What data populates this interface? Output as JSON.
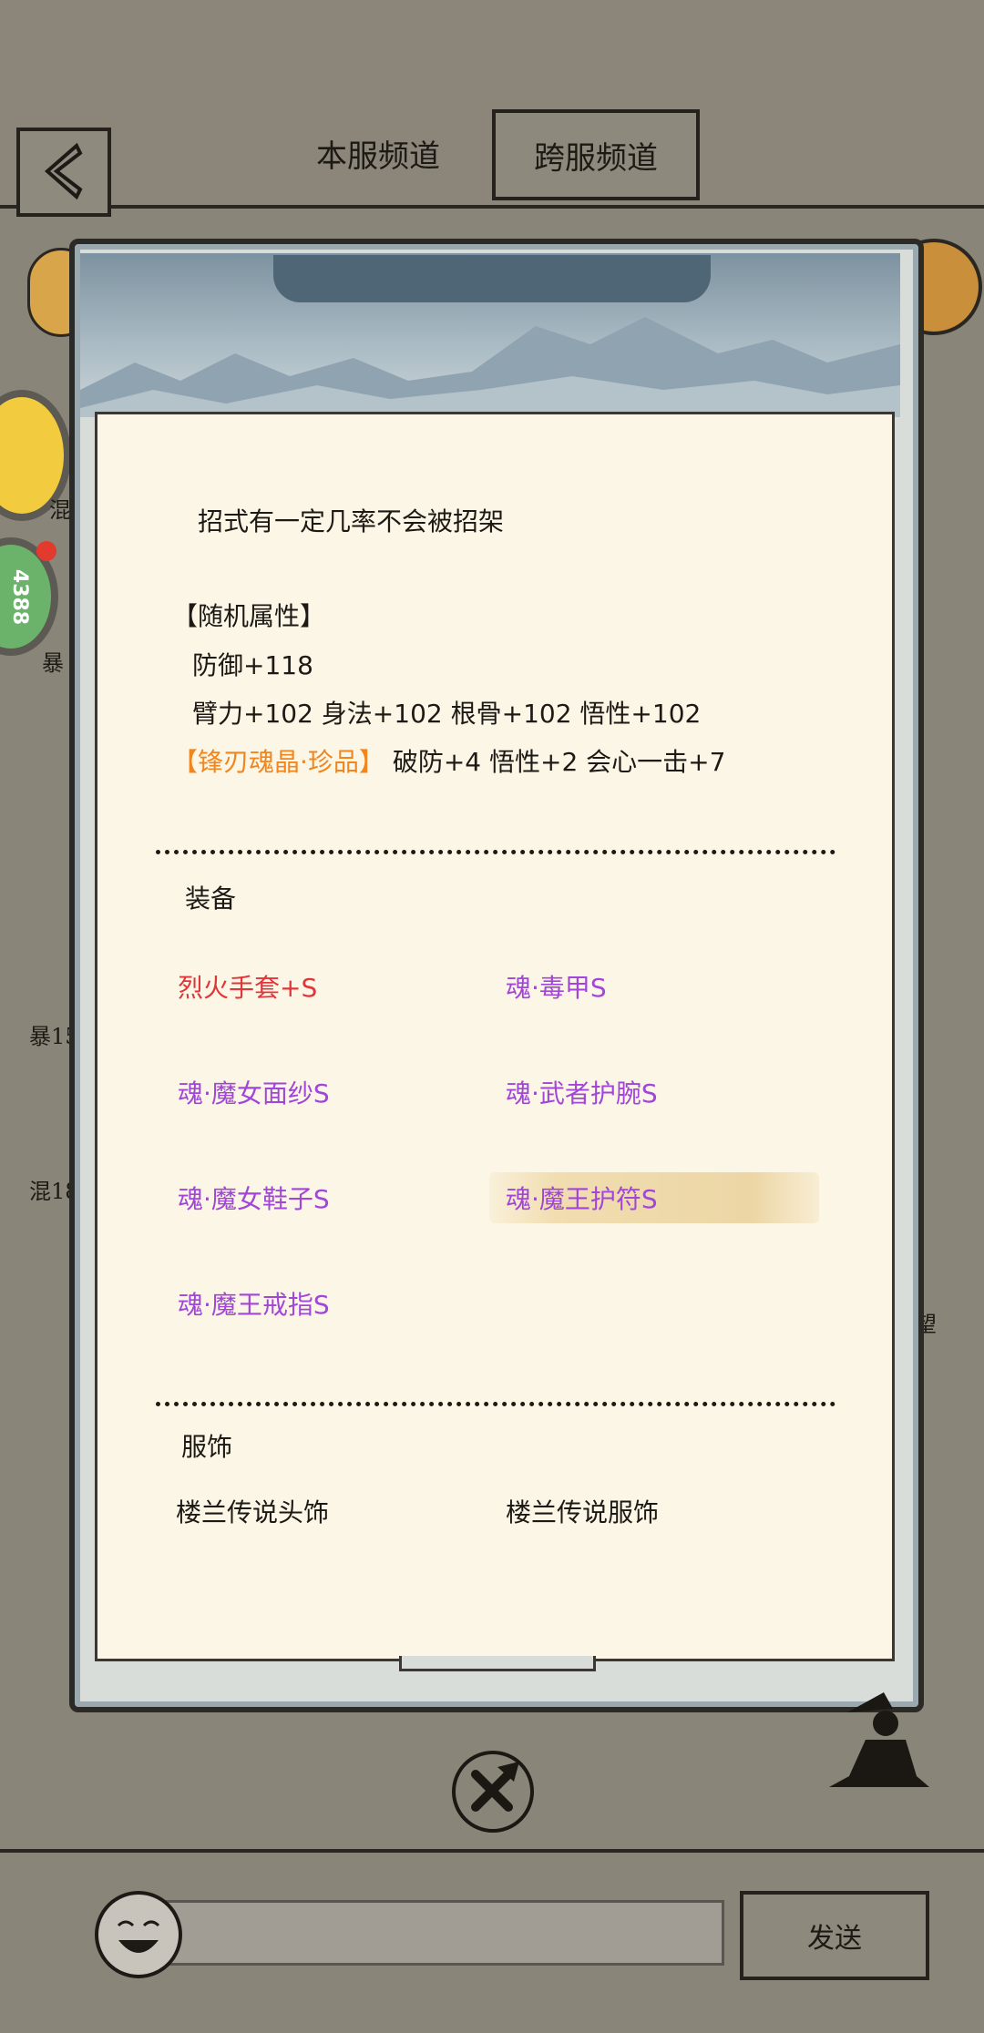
{
  "tabs": {
    "local": "本服频道",
    "cross": "跨服频道"
  },
  "background_texts": {
    "left_a": "混",
    "left_b": "暴",
    "left_c": "暴15",
    "left_d": "混18",
    "right_a": "望",
    "badge": "4388"
  },
  "popup": {
    "skill_desc": "招式有一定几率不会被招架",
    "random_attr_title": "【随机属性】",
    "attr_line1": "防御+118",
    "attr_line2": "臂力+102 身法+102 根骨+102 悟性+102",
    "gem_name": "【锋刃魂晶·珍品】",
    "gem_effects": "破防+4 悟性+2 会心一击+7",
    "equip_title": "装备",
    "equipment": [
      {
        "name": "烈火手套+S",
        "color": "red"
      },
      {
        "name": "魂·毒甲S",
        "color": "purple"
      },
      {
        "name": "魂·魔女面纱S",
        "color": "purple"
      },
      {
        "name": "魂·武者护腕S",
        "color": "purple"
      },
      {
        "name": "魂·魔女鞋子S",
        "color": "purple"
      },
      {
        "name": "魂·魔王护符S",
        "color": "purple"
      },
      {
        "name": "魂·魔王戒指S",
        "color": "purple"
      }
    ],
    "costume_title": "服饰",
    "costumes": [
      "楼兰传说头饰",
      "楼兰传说服饰"
    ]
  },
  "input": {
    "send_label": "发送"
  },
  "colors": {
    "red": "#e0353a",
    "purple": "#a146d9",
    "orange": "#f0861d",
    "paper": "#fcf6e6",
    "frame": "#2c2a27"
  }
}
